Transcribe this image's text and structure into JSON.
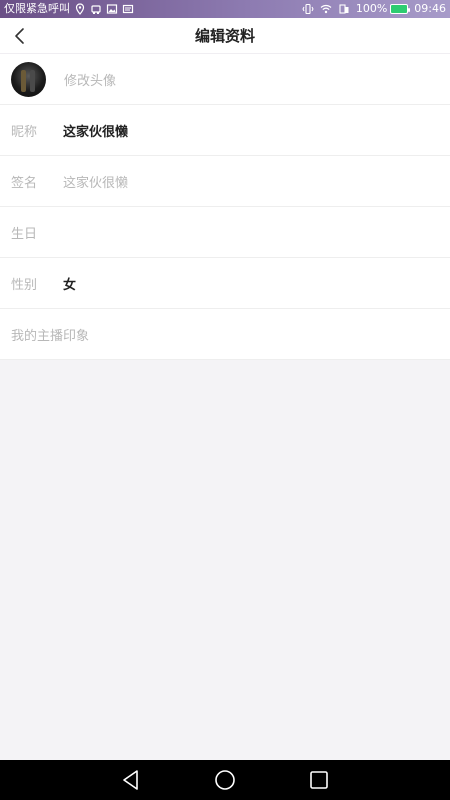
{
  "statusbar": {
    "carrier_text": "仅限紧急呼叫",
    "battery": "100%",
    "time": "09:46",
    "icons": [
      "location-icon",
      "car-icon",
      "image-icon",
      "message-icon",
      "vibrate-icon",
      "wifi-icon",
      "sim-icon",
      "battery-icon"
    ]
  },
  "header": {
    "title": "编辑资料",
    "back_icon": "chevron-left-icon"
  },
  "profile": {
    "avatar_action": "修改头像",
    "nickname_label": "昵称",
    "nickname_value": "这家伙很懒",
    "signature_label": "签名",
    "signature_value": "这家伙很懒",
    "birthday_label": "生日",
    "birthday_value": "",
    "gender_label": "性别",
    "gender_value": "女",
    "impression_label": "我的主播印象"
  },
  "navbar": {
    "icons": [
      "back-triangle-icon",
      "home-circle-icon",
      "recents-square-icon"
    ]
  }
}
